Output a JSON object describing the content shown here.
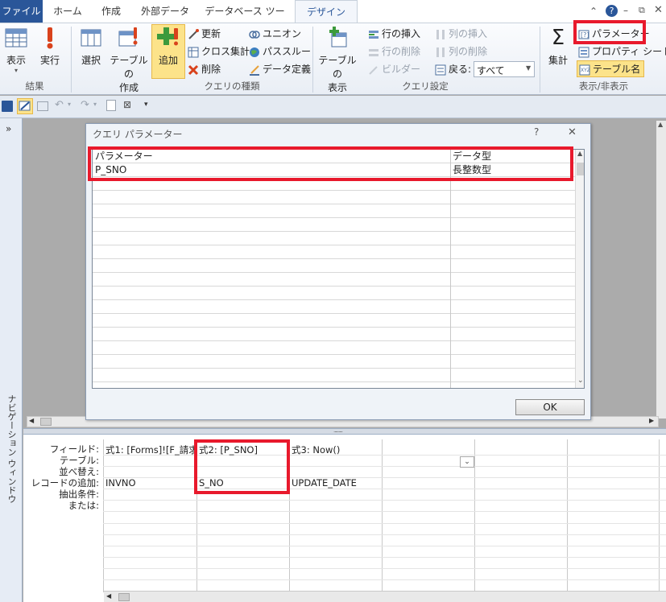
{
  "tabs": {
    "file": "ファイル",
    "home": "ホーム",
    "create": "作成",
    "external": "外部データ",
    "dbtools": "データベース ツール",
    "design": "デザイン"
  },
  "ribbon": {
    "results": {
      "view": "表示",
      "run": "実行",
      "label": "結果"
    },
    "query_type": {
      "select": "選択",
      "make_table_l1": "テーブルの",
      "make_table_l2": "作成",
      "append": "追加",
      "update": "更新",
      "crosstab": "クロス集計",
      "delete": "削除",
      "union": "ユニオン",
      "passthrough": "パススルー",
      "data_def": "データ定義",
      "label": "クエリの種類"
    },
    "query_setup": {
      "show_table_l1": "テーブルの",
      "show_table_l2": "表示",
      "insert_rows": "行の挿入",
      "delete_rows": "行の削除",
      "builder": "ビルダー",
      "insert_cols": "列の挿入",
      "delete_cols": "列の削除",
      "return_label": "戻る:",
      "return_value": "すべて",
      "label": "クエリ設定"
    },
    "show_hide": {
      "totals": "集計",
      "parameters": "パラメーター",
      "property_sheet": "プロパティ シート",
      "table_names": "テーブル名",
      "label": "表示/非表示"
    }
  },
  "nav_pane": {
    "label": "ナビゲーション ウィンドウ"
  },
  "dialog": {
    "title": "クエリ パラメーター",
    "help": "?",
    "close": "✕",
    "header_param": "パラメーター",
    "header_type": "データ型",
    "rows": [
      {
        "param": "P_SNO",
        "type": "長整数型"
      }
    ],
    "ok": "OK"
  },
  "design_grid": {
    "row_labels": [
      "フィールド:",
      "テーブル:",
      "並べ替え:",
      "レコードの追加:",
      "抽出条件:",
      "または:"
    ],
    "columns": [
      {
        "field": "式1: [Forms]![F_請求",
        "append_to": "INVNO"
      },
      {
        "field": "式2: [P_SNO]",
        "append_to": "S_NO"
      },
      {
        "field": "式3: Now()",
        "append_to": "UPDATE_DATE"
      }
    ]
  },
  "colors": {
    "highlight": "#E8192C",
    "file_tab": "#2A5699",
    "accent_bg": "#FCE38A"
  }
}
